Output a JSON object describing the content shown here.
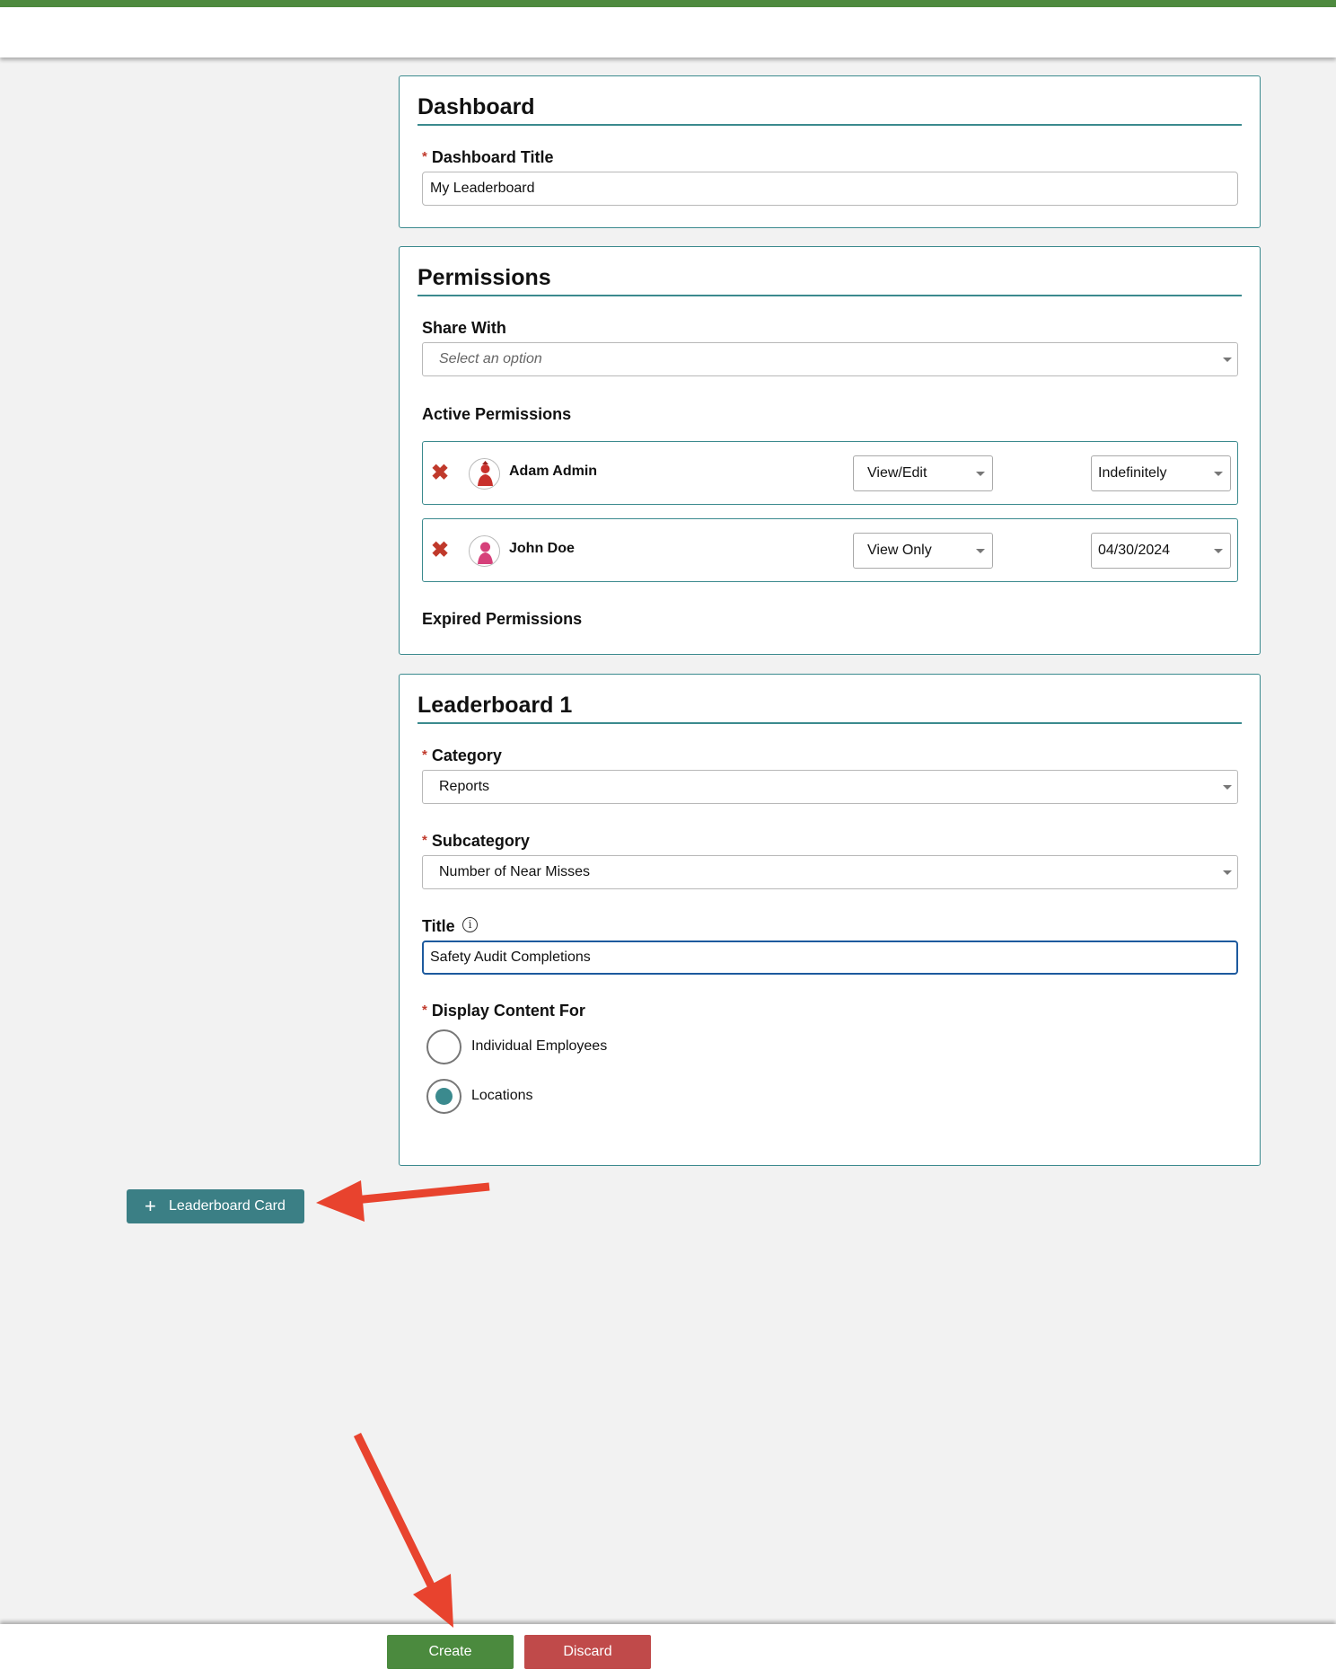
{
  "dashboard": {
    "heading": "Dashboard",
    "title_label": "Dashboard Title",
    "title_value": "My Leaderboard"
  },
  "permissions": {
    "heading": "Permissions",
    "share_with_label": "Share With",
    "share_with_placeholder": "Select an option",
    "active_label": "Active Permissions",
    "expired_label": "Expired Permissions",
    "rows": [
      {
        "name": "Adam Admin",
        "access": "View/Edit",
        "duration": "Indefinitely",
        "avatar_color": "#c8302c"
      },
      {
        "name": "John Doe",
        "access": "View Only",
        "duration": "04/30/2024",
        "avatar_color": "#d6407a"
      }
    ],
    "remove_glyph": "✖"
  },
  "leaderboard": {
    "heading": "Leaderboard 1",
    "category_label": "Category",
    "category_value": "Reports",
    "subcategory_label": "Subcategory",
    "subcategory_value": "Number of Near Misses",
    "title_label": "Title",
    "title_value": "Safety Audit Completions",
    "display_label": "Display Content For",
    "options": [
      {
        "label": "Individual Employees",
        "checked": false
      },
      {
        "label": "Locations",
        "checked": true
      }
    ]
  },
  "add_card_button": {
    "icon": "plus-icon",
    "label": "Leaderboard Card"
  },
  "footer": {
    "create_label": "Create",
    "discard_label": "Discard"
  },
  "colors": {
    "brand_green": "#4e8a3f",
    "teal": "#3b8a8e",
    "danger": "#c04a4a",
    "annotation_arrow": "#e8432e"
  }
}
